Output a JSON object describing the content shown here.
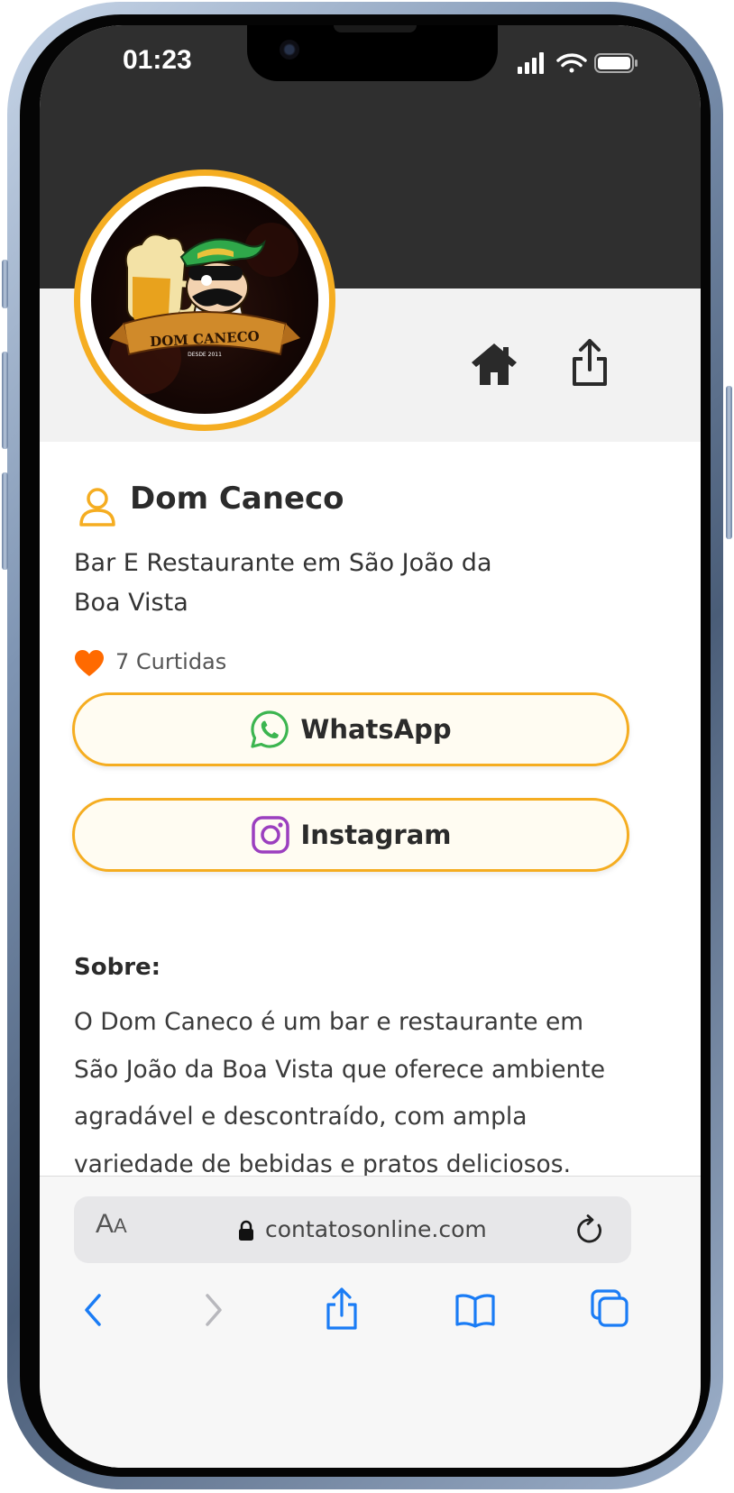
{
  "status_bar": {
    "time": "01:23"
  },
  "profile": {
    "logo_alt": "Dom Caneco logo",
    "name": "Dom Caneco",
    "subtitle": "Bar E Restaurante em São João da Boa Vista",
    "likes": "7 Curtidas"
  },
  "header_actions": {
    "home_icon": "home-icon",
    "share_icon": "share-icon"
  },
  "buttons": [
    {
      "label": "WhatsApp",
      "icon": "whatsapp-icon",
      "color": "#3cb550"
    },
    {
      "label": "Instagram",
      "icon": "instagram-icon",
      "color": "#9b3fbf"
    }
  ],
  "about": {
    "title": "Sobre:",
    "text": "O Dom Caneco é um bar e restaurante em São João da Boa Vista que oferece ambiente agradável e descontraído, com ampla variedade de bebidas e pratos deliciosos."
  },
  "browser": {
    "text_size_label_big": "A",
    "text_size_label_small": "A",
    "url": "contatosonline.com"
  },
  "colors": {
    "accent": "#f5ad21",
    "header_dark": "#2f2f2f",
    "heart": "#ff6a00",
    "ios_blue": "#1a7cf5"
  }
}
